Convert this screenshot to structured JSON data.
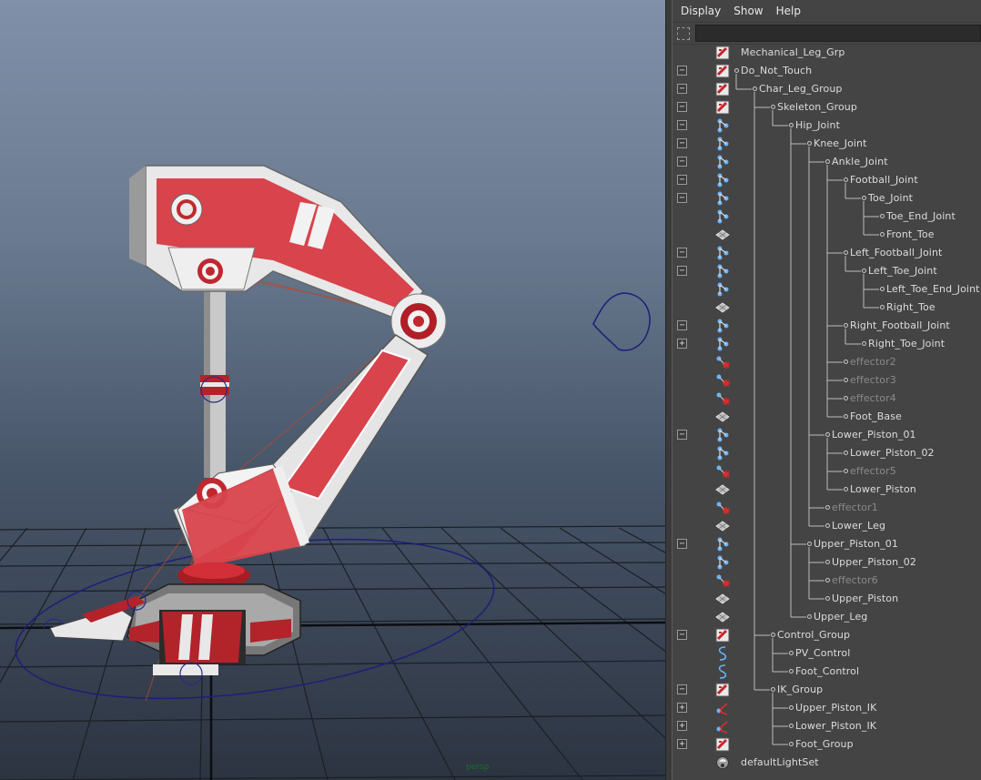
{
  "menu": [
    "Display",
    "Show",
    "Help"
  ],
  "filter": {
    "value": ""
  },
  "viewport": {
    "status_text": "persp"
  },
  "tree": [
    {
      "label": "Mechanical_Leg_Grp",
      "icon": "transform-icon",
      "depth": 0,
      "expander": "",
      "dim": false
    },
    {
      "label": "Do_Not_Touch",
      "icon": "transform-icon",
      "depth": 0,
      "expander": "minus",
      "dim": false
    },
    {
      "label": "Char_Leg_Group",
      "icon": "transform-icon",
      "depth": 1,
      "expander": "minus",
      "dim": false
    },
    {
      "label": "Skeleton_Group",
      "icon": "transform-icon",
      "depth": 2,
      "expander": "minus",
      "dim": false
    },
    {
      "label": "Hip_Joint",
      "icon": "joint-icon",
      "depth": 3,
      "expander": "minus",
      "dim": false
    },
    {
      "label": "Knee_Joint",
      "icon": "joint-icon",
      "depth": 4,
      "expander": "minus",
      "dim": false
    },
    {
      "label": "Ankle_Joint",
      "icon": "joint-icon",
      "depth": 5,
      "expander": "minus",
      "dim": false
    },
    {
      "label": "Football_Joint",
      "icon": "joint-icon",
      "depth": 6,
      "expander": "minus",
      "dim": false
    },
    {
      "label": "Toe_Joint",
      "icon": "joint-icon",
      "depth": 7,
      "expander": "minus",
      "dim": false
    },
    {
      "label": "Toe_End_Joint",
      "icon": "joint-icon",
      "depth": 8,
      "expander": "",
      "dim": false
    },
    {
      "label": "Front_Toe",
      "icon": "mesh-icon",
      "depth": 8,
      "expander": "",
      "dim": false
    },
    {
      "label": "Left_Football_Joint",
      "icon": "joint-icon",
      "depth": 6,
      "expander": "minus",
      "dim": false
    },
    {
      "label": "Left_Toe_Joint",
      "icon": "joint-icon",
      "depth": 7,
      "expander": "minus",
      "dim": false
    },
    {
      "label": "Left_Toe_End_Joint",
      "icon": "joint-icon",
      "depth": 8,
      "expander": "",
      "dim": false
    },
    {
      "label": "Right_Toe",
      "icon": "mesh-icon",
      "depth": 8,
      "expander": "",
      "dim": false
    },
    {
      "label": "Right_Football_Joint",
      "icon": "joint-icon",
      "depth": 6,
      "expander": "minus",
      "dim": false
    },
    {
      "label": "Right_Toe_Joint",
      "icon": "joint-icon",
      "depth": 7,
      "expander": "plus",
      "dim": false
    },
    {
      "label": "effector2",
      "icon": "effector-icon",
      "depth": 6,
      "expander": "",
      "dim": true
    },
    {
      "label": "effector3",
      "icon": "effector-icon",
      "depth": 6,
      "expander": "",
      "dim": true
    },
    {
      "label": "effector4",
      "icon": "effector-icon",
      "depth": 6,
      "expander": "",
      "dim": true
    },
    {
      "label": "Foot_Base",
      "icon": "mesh-icon",
      "depth": 6,
      "expander": "",
      "dim": false
    },
    {
      "label": "Lower_Piston_01",
      "icon": "joint-icon",
      "depth": 5,
      "expander": "minus",
      "dim": false
    },
    {
      "label": "Lower_Piston_02",
      "icon": "joint-icon",
      "depth": 6,
      "expander": "",
      "dim": false
    },
    {
      "label": "effector5",
      "icon": "effector-icon",
      "depth": 6,
      "expander": "",
      "dim": true
    },
    {
      "label": "Lower_Piston",
      "icon": "mesh-icon",
      "depth": 6,
      "expander": "",
      "dim": false
    },
    {
      "label": "effector1",
      "icon": "effector-icon",
      "depth": 5,
      "expander": "",
      "dim": true
    },
    {
      "label": "Lower_Leg",
      "icon": "mesh-icon",
      "depth": 5,
      "expander": "",
      "dim": false
    },
    {
      "label": "Upper_Piston_01",
      "icon": "joint-icon",
      "depth": 4,
      "expander": "minus",
      "dim": false
    },
    {
      "label": "Upper_Piston_02",
      "icon": "joint-icon",
      "depth": 5,
      "expander": "",
      "dim": false
    },
    {
      "label": "effector6",
      "icon": "effector-icon",
      "depth": 5,
      "expander": "",
      "dim": true
    },
    {
      "label": "Upper_Piston",
      "icon": "mesh-icon",
      "depth": 5,
      "expander": "",
      "dim": false
    },
    {
      "label": "Upper_Leg",
      "icon": "mesh-icon",
      "depth": 4,
      "expander": "",
      "dim": false
    },
    {
      "label": "Control_Group",
      "icon": "transform-icon",
      "depth": 2,
      "expander": "minus",
      "dim": false
    },
    {
      "label": "PV_Control",
      "icon": "curve-icon",
      "depth": 3,
      "expander": "",
      "dim": false
    },
    {
      "label": "Foot_Control",
      "icon": "curve-icon",
      "depth": 3,
      "expander": "",
      "dim": false
    },
    {
      "label": "IK_Group",
      "icon": "transform-icon",
      "depth": 2,
      "expander": "minus",
      "dim": false
    },
    {
      "label": "Upper_Piston_IK",
      "icon": "ik-handle-icon",
      "depth": 3,
      "expander": "plus",
      "dim": false
    },
    {
      "label": "Lower_Piston_IK",
      "icon": "ik-handle-icon",
      "depth": 3,
      "expander": "plus",
      "dim": false
    },
    {
      "label": "Foot_Group",
      "icon": "transform-icon",
      "depth": 3,
      "expander": "plus",
      "dim": false
    },
    {
      "label": "defaultLightSet",
      "icon": "light-set-icon",
      "depth": -1,
      "expander": "",
      "dim": false
    }
  ]
}
